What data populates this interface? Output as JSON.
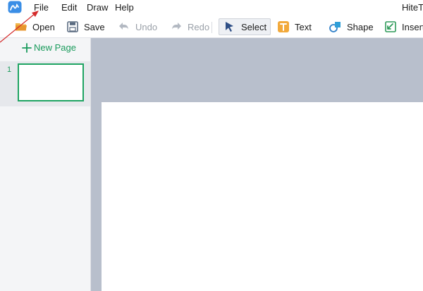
{
  "menubar": {
    "items": [
      "File",
      "Edit",
      "Draw",
      "Help"
    ],
    "app_title": "HiteT"
  },
  "toolbar": {
    "open": "Open",
    "save": "Save",
    "undo": "Undo",
    "redo": "Redo",
    "select": "Select",
    "text": "Text",
    "shape": "Shape",
    "insert": "Insert"
  },
  "sidebar": {
    "new_page": "New Page",
    "pages": [
      {
        "number": "1"
      }
    ]
  },
  "colors": {
    "accent": "#1a9b5c",
    "canvas_bg": "#b8bfcc",
    "annotation_arrow": "#d42a2a"
  }
}
